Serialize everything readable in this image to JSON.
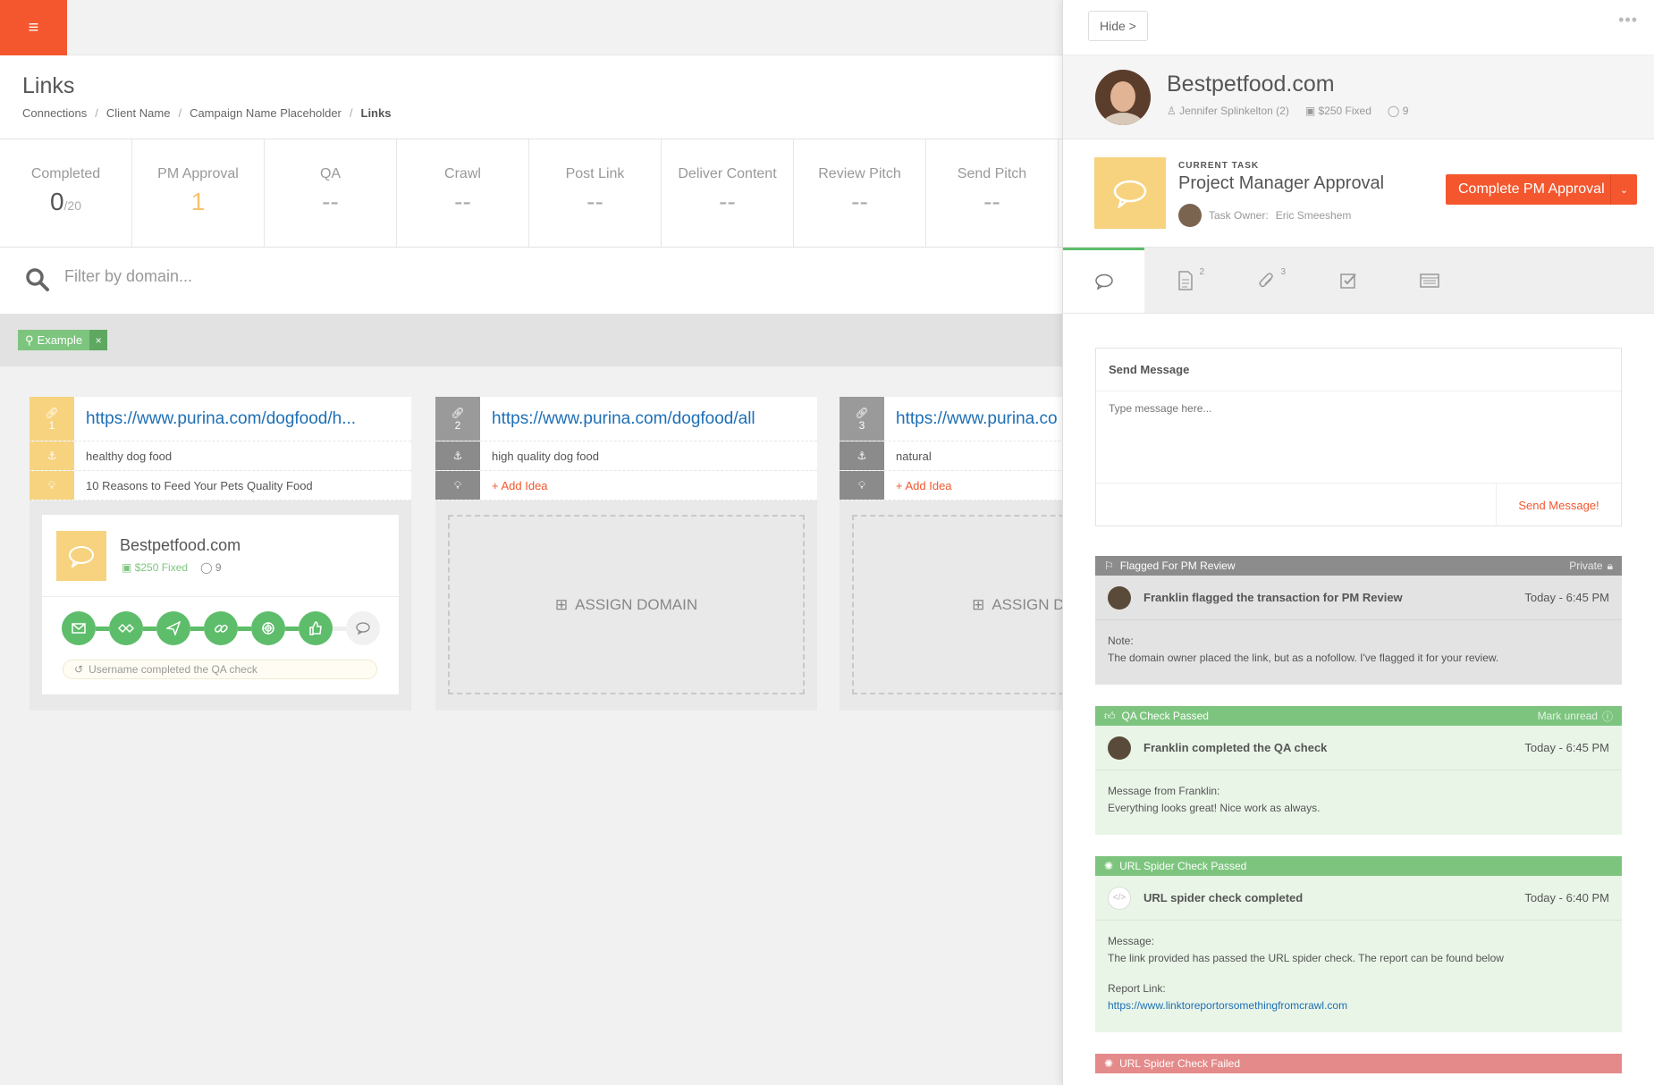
{
  "topbar": {
    "menu_icon": "menu-icon"
  },
  "page": {
    "title": "Links",
    "breadcrumb": [
      "Connections",
      "Client Name",
      "Campaign Name Placeholder",
      "Links"
    ]
  },
  "stats": [
    {
      "label": "Completed",
      "value": "0",
      "suffix": "/20"
    },
    {
      "label": "PM Approval",
      "value": "1",
      "suffix": ""
    },
    {
      "label": "QA",
      "value": "--",
      "suffix": ""
    },
    {
      "label": "Crawl",
      "value": "--",
      "suffix": ""
    },
    {
      "label": "Post Link",
      "value": "--",
      "suffix": ""
    },
    {
      "label": "Deliver Content",
      "value": "--",
      "suffix": ""
    },
    {
      "label": "Review Pitch",
      "value": "--",
      "suffix": ""
    },
    {
      "label": "Send Pitch",
      "value": "--",
      "suffix": ""
    }
  ],
  "filter": {
    "placeholder": "Filter by domain..."
  },
  "tag": {
    "label": "Example",
    "remove": "×"
  },
  "cards": [
    {
      "num": "1",
      "url": "https://www.purina.com/dogfood/h...",
      "anchor": "healthy dog food",
      "idea": "10 Reasons to Feed Your Pets Quality Food",
      "domain": "Bestpetfood.com",
      "price": "$250 Fixed",
      "comments": "9",
      "log": "Username completed the QA check"
    },
    {
      "num": "2",
      "url": "https://www.purina.com/dogfood/all",
      "anchor": "high quality dog food",
      "idea": "+ Add Idea",
      "assign": "ASSIGN DOMAIN"
    },
    {
      "num": "3",
      "url": "https://www.purina.co",
      "anchor": "natural",
      "idea": "+ Add Idea",
      "assign": "ASSIGN DOM"
    }
  ],
  "panel": {
    "hide_label": "Hide >",
    "dots": "•••",
    "domain": "Bestpetfood.com",
    "contact": "Jennifer Splinkelton (2)",
    "price": "$250 Fixed",
    "comments": "9",
    "current_task_label": "CURRENT TASK",
    "task_title": "Project Manager Approval",
    "task_owner_label": "Task Owner:",
    "task_owner": "Eric Smeeshem",
    "complete_button": "Complete PM Approval",
    "tabs": [
      {
        "icon": "chat-icon",
        "count": ""
      },
      {
        "icon": "document-icon",
        "count": "2"
      },
      {
        "icon": "paperclip-icon",
        "count": "3"
      },
      {
        "icon": "checkbox-icon",
        "count": ""
      },
      {
        "icon": "list-icon",
        "count": ""
      }
    ],
    "send_message": {
      "title": "Send Message",
      "placeholder": "Type message here...",
      "button": "Send Message!"
    },
    "activities": [
      {
        "type": "Flagged For PM Review",
        "badge": "Private",
        "who": "Franklin flagged the transaction for PM Review",
        "time": "Today - 6:45 PM",
        "label": "Note:",
        "text": "The domain owner placed the link, but as a nofollow. I've flagged it for your review."
      },
      {
        "type": "QA Check Passed",
        "badge": "Mark unread",
        "who": "Franklin completed the QA check",
        "time": "Today - 6:45 PM",
        "label": "Message from Franklin:",
        "text": "Everything looks great! Nice work as always."
      },
      {
        "type": "URL Spider Check Passed",
        "badge": "",
        "who": "URL spider check completed",
        "time": "Today - 6:40 PM",
        "label": "Message:",
        "text": "The link provided has passed the URL spider check. The report can be found below",
        "link_label": "Report Link:",
        "link": "https://www.linktoreportorsomethingfromcrawl.com"
      },
      {
        "type": "URL Spider Check Failed",
        "badge": ""
      }
    ]
  },
  "colors": {
    "accent": "#f4572e",
    "green": "#7dc57f",
    "yellow": "#f7d37f",
    "link": "#1e6fb5"
  }
}
